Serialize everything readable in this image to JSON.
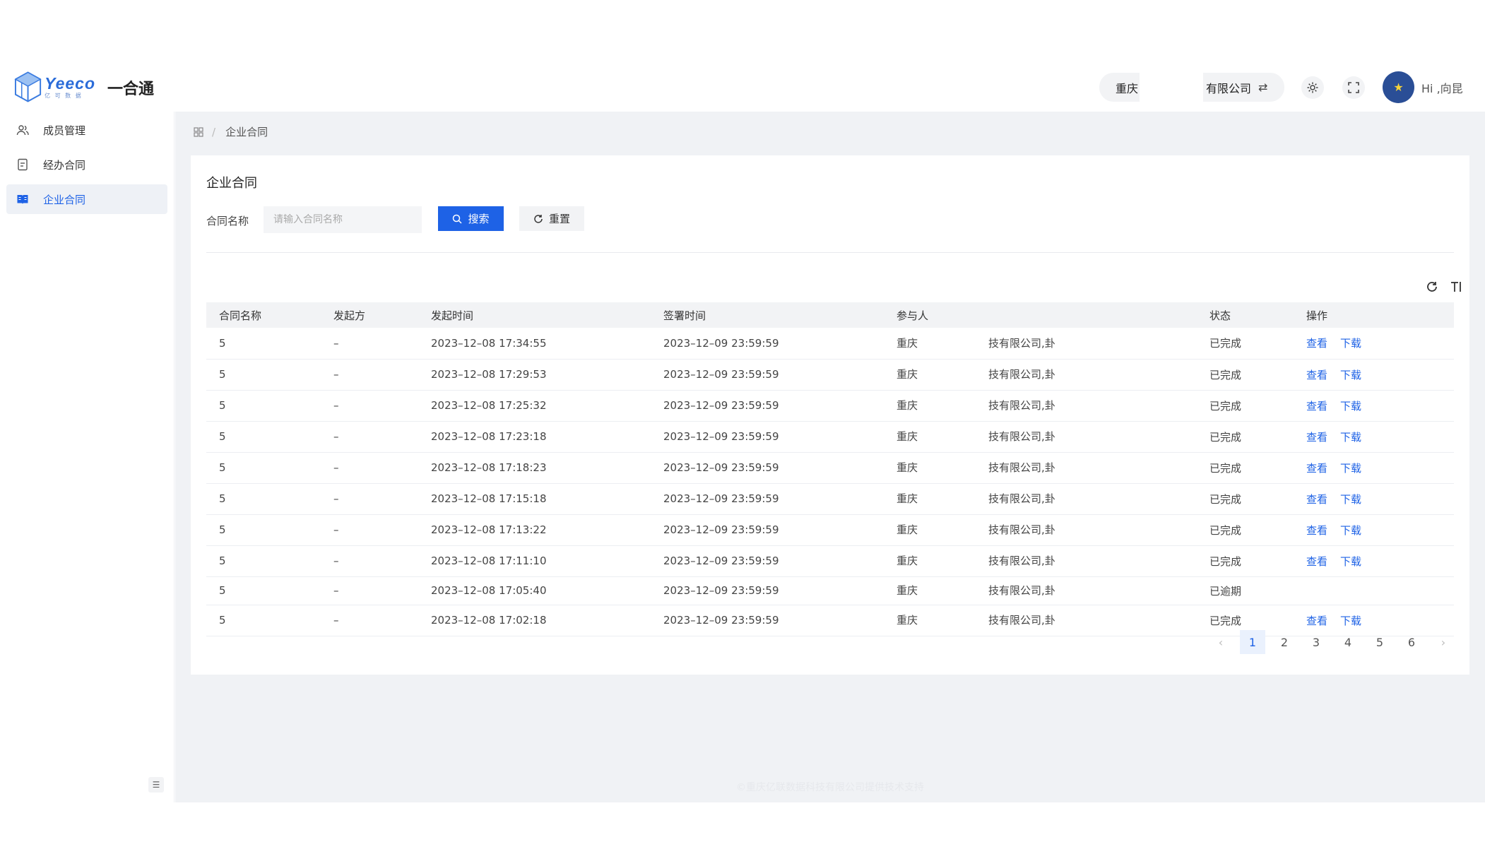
{
  "header": {
    "logo_word": "Yeeco",
    "logo_sub": "亿 可 数 据",
    "app_title": "一合通",
    "company_prefix": "重庆",
    "company_suffix": "有限公司",
    "swap_icon": "⇄",
    "greeting": "Hi ,向昆"
  },
  "sidebar": {
    "items": [
      {
        "label": "成员管理",
        "icon": "users-icon",
        "active": false
      },
      {
        "label": "经办合同",
        "icon": "document-icon",
        "active": false
      },
      {
        "label": "企业合同",
        "icon": "book-icon",
        "active": true
      }
    ]
  },
  "breadcrumb": {
    "current": "企业合同"
  },
  "card": {
    "title": "企业合同",
    "search_label": "合同名称",
    "search_placeholder": "请输入合同名称",
    "search_button": "搜索",
    "reset_button": "重置"
  },
  "table": {
    "columns": [
      "合同名称",
      "发起方",
      "发起时间",
      "签署时间",
      "参与人",
      "状态",
      "操作"
    ],
    "rows": [
      {
        "name": "5",
        "initiator": "–",
        "start": "2023–12–08 17:34:55",
        "sign": "2023–12–09 23:59:59",
        "p1": "重庆",
        "p2": "技有限公司,卦",
        "status": "已完成",
        "actions": [
          "查看",
          "下载"
        ]
      },
      {
        "name": "5",
        "initiator": "–",
        "start": "2023–12–08 17:29:53",
        "sign": "2023–12–09 23:59:59",
        "p1": "重庆",
        "p2": "技有限公司,卦",
        "status": "已完成",
        "actions": [
          "查看",
          "下载"
        ]
      },
      {
        "name": "5",
        "initiator": "–",
        "start": "2023–12–08 17:25:32",
        "sign": "2023–12–09 23:59:59",
        "p1": "重庆",
        "p2": "技有限公司,卦",
        "status": "已完成",
        "actions": [
          "查看",
          "下载"
        ]
      },
      {
        "name": "5",
        "initiator": "–",
        "start": "2023–12–08 17:23:18",
        "sign": "2023–12–09 23:59:59",
        "p1": "重庆",
        "p2": "技有限公司,卦",
        "status": "已完成",
        "actions": [
          "查看",
          "下载"
        ]
      },
      {
        "name": "5",
        "initiator": "–",
        "start": "2023–12–08 17:18:23",
        "sign": "2023–12–09 23:59:59",
        "p1": "重庆",
        "p2": "技有限公司,卦",
        "status": "已完成",
        "actions": [
          "查看",
          "下载"
        ]
      },
      {
        "name": "5",
        "initiator": "–",
        "start": "2023–12–08 17:15:18",
        "sign": "2023–12–09 23:59:59",
        "p1": "重庆",
        "p2": "技有限公司,卦",
        "status": "已完成",
        "actions": [
          "查看",
          "下载"
        ]
      },
      {
        "name": "5",
        "initiator": "–",
        "start": "2023–12–08 17:13:22",
        "sign": "2023–12–09 23:59:59",
        "p1": "重庆",
        "p2": "技有限公司,卦",
        "status": "已完成",
        "actions": [
          "查看",
          "下载"
        ]
      },
      {
        "name": "5",
        "initiator": "–",
        "start": "2023–12–08 17:11:10",
        "sign": "2023–12–09 23:59:59",
        "p1": "重庆",
        "p2": "技有限公司,卦",
        "status": "已完成",
        "actions": [
          "查看",
          "下载"
        ]
      },
      {
        "name": "5",
        "initiator": "–",
        "start": "2023–12–08 17:05:40",
        "sign": "2023–12–09 23:59:59",
        "p1": "重庆",
        "p2": "技有限公司,卦",
        "status": "已逾期",
        "actions": []
      },
      {
        "name": "5",
        "initiator": "–",
        "start": "2023–12–08 17:02:18",
        "sign": "2023–12–09 23:59:59",
        "p1": "重庆",
        "p2": "技有限公司,卦",
        "status": "已完成",
        "actions": [
          "查看",
          "下载"
        ]
      }
    ]
  },
  "pagination": {
    "prev": "‹",
    "next": "›",
    "pages": [
      "1",
      "2",
      "3",
      "4",
      "5",
      "6"
    ],
    "current": "1"
  },
  "footer": {
    "text": "©重庆亿联数据科技有限公司提供技术支持"
  },
  "colors": {
    "accent": "#1e62e6",
    "background": "#f0f2f5",
    "avatar": "#2a4e96"
  }
}
